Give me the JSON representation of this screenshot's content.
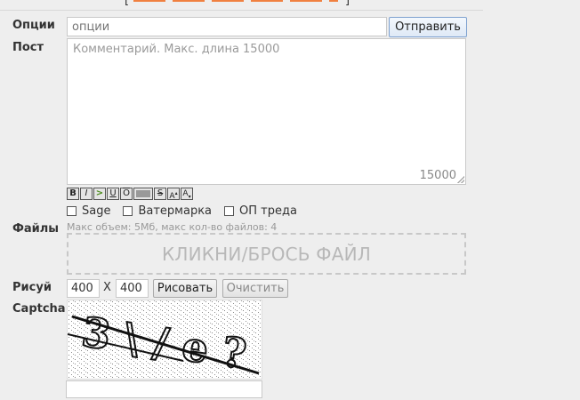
{
  "form": {
    "options": {
      "label": "Опции",
      "placeholder": "опции",
      "submit_label": "Отправить"
    },
    "post": {
      "label": "Пост",
      "placeholder": "Комментарий. Макс. длина 15000",
      "counter": "15000"
    },
    "toolbar": [
      {
        "name": "bold-button",
        "glyph": "B"
      },
      {
        "name": "italic-button",
        "glyph": "I"
      },
      {
        "name": "quote-button",
        "glyph": ">"
      },
      {
        "name": "underline-button",
        "glyph": "U"
      },
      {
        "name": "overline-button",
        "glyph": "O"
      },
      {
        "name": "spoiler-button",
        "glyph": ""
      },
      {
        "name": "strike-button",
        "glyph": "S"
      },
      {
        "name": "superscript-button",
        "glyph": "A"
      },
      {
        "name": "subscript-button",
        "glyph": "A"
      }
    ],
    "checkboxes": [
      {
        "label": "Sage",
        "checked": false
      },
      {
        "label": "Ватермарка",
        "checked": false
      },
      {
        "label": "ОП треда",
        "checked": false
      }
    ],
    "files": {
      "label": "Файлы",
      "info": "Макс объем: 5Мб, макс кол-во файлов: 4",
      "dropzone_text": "КЛИКНИ/БРОСЬ ФАЙЛ"
    },
    "draw": {
      "label": "Рисуй",
      "width": "400",
      "times": "X",
      "height": "400",
      "draw_label": "Рисовать",
      "clear_label": "Очистить"
    },
    "captcha": {
      "label": "Captcha",
      "answer_value": ""
    }
  },
  "colors": {
    "accent_border": "#7fa2d0",
    "background": "#eeeeee",
    "top_accent": "#f08040"
  }
}
